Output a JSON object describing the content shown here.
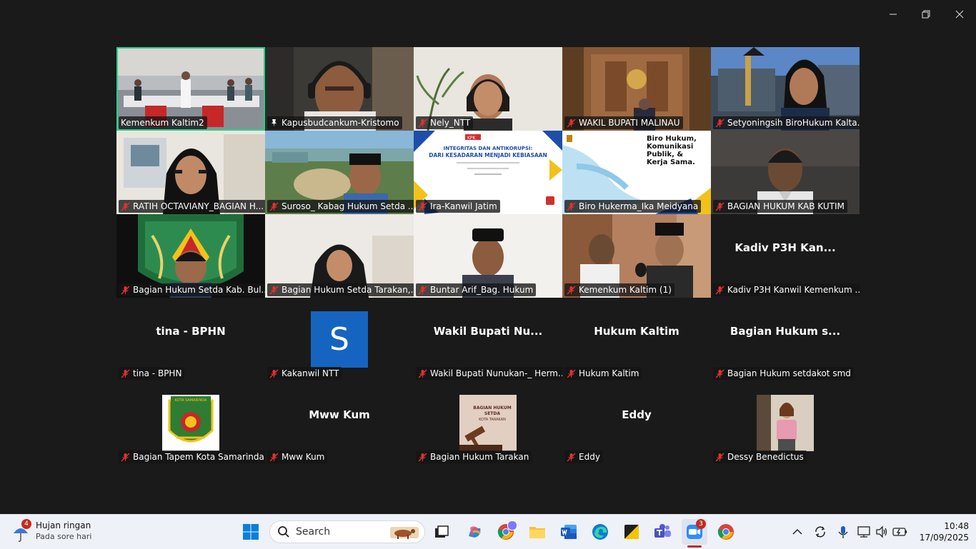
{
  "window": {
    "controls": [
      "minimize",
      "maximize",
      "close"
    ]
  },
  "participants": [
    {
      "name": "Kemenkum Kaltim2",
      "mic": "muted",
      "active": true
    },
    {
      "name": "Kapusbudcankum-Kristomo",
      "mic": "pinned"
    },
    {
      "name": "Nely_NTT",
      "mic": "muted"
    },
    {
      "name": "WAKIL BUPATI MALINAU",
      "mic": "muted"
    },
    {
      "name": "Setyoningsih BiroHukum Kalta...",
      "mic": "muted"
    },
    {
      "name": "RATIH OCTAVIANY_BAGIAN H...",
      "mic": "muted"
    },
    {
      "name": "Suroso_ Kabag Hukum Setda ...",
      "mic": "muted"
    },
    {
      "name": "Ira-Kanwil Jatim",
      "mic": "muted"
    },
    {
      "name": "Biro Hukerma_Ika Meidyana",
      "mic": "muted"
    },
    {
      "name": "BAGIAN HUKUM KAB KUTIM",
      "mic": "muted"
    },
    {
      "name": "Bagian Hukum Setda Kab. Bul...",
      "mic": "muted"
    },
    {
      "name": "Bagian Hukum Setda Tarakan,...",
      "mic": "muted"
    },
    {
      "name": "Buntar Arif_Bag. Hukum",
      "mic": "muted"
    },
    {
      "name": "Kemenkum Kaltim (1)",
      "mic": "muted"
    },
    {
      "name": "Kadiv P3H Kanwil Kemenkum ...",
      "display": "Kadiv P3H Kan...",
      "mic": "muted"
    },
    {
      "name": "tina - BPHN",
      "display": "tina - BPHN",
      "mic": "muted"
    },
    {
      "name": "Kakanwil NTT",
      "avatar_letter": "S",
      "mic": "muted"
    },
    {
      "name": "Wakil Bupati Nunukan-_ Herm...",
      "display": "Wakil Bupati Nu...",
      "mic": "muted"
    },
    {
      "name": "Hukum Kaltim",
      "display": "Hukum Kaltim",
      "mic": "muted"
    },
    {
      "name": "Bagian Hukum setdakot smd",
      "display": "Bagian Hukum s...",
      "mic": "muted"
    },
    {
      "name": "Bagian Tapem Kota Samarinda",
      "mic": "muted"
    },
    {
      "name": "Mww Kum",
      "display": "Mww Kum",
      "mic": "muted"
    },
    {
      "name": "Bagian Hukum Tarakan",
      "mic": "muted"
    },
    {
      "name": "Eddy",
      "display": "Eddy",
      "mic": "muted"
    },
    {
      "name": "Dessy Benedictus",
      "mic": "muted"
    }
  ],
  "slides": {
    "integritas_title1": "INTEGRITAS DAN ANTIKORUPSI:",
    "integritas_title2": "DARI KESADARAN MENJADI KEBIASAAN",
    "biro_line1": "Biro Hukum,",
    "biro_line2": "Komunikasi",
    "biro_line3": "Publik, &",
    "biro_line4": "Kerja Sama.",
    "kpk_logo": "KPK",
    "kota_samarinda": "KOTA SAMARINDA",
    "tarakan_line1": "BAGIAN HUKUM",
    "tarakan_line2": "SETDA",
    "tarakan_line3": "KOTA TARAKAN"
  },
  "taskbar": {
    "weather_badge": "4",
    "weather_title": "Hujan ringan",
    "weather_sub": "Pada sore hari",
    "search_placeholder": "Search",
    "zoom_badge": "3",
    "time": "10:48",
    "date": "17/09/2025"
  },
  "colors": {
    "active_border": "#23d18b",
    "muted_red": "#e0312f",
    "avatar_blue": "#1565c0"
  }
}
